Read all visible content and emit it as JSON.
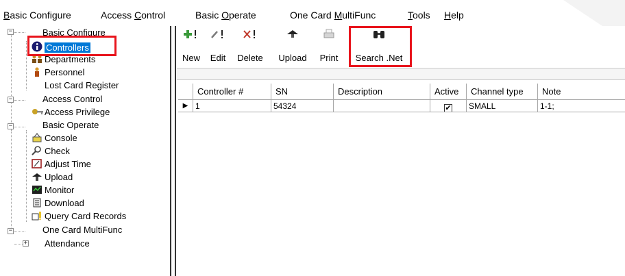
{
  "menu": [
    {
      "prefix": "",
      "accel": "B",
      "rest": "asic Configure"
    },
    {
      "prefix": "Access ",
      "accel": "C",
      "rest": "ontrol"
    },
    {
      "prefix": "Basic ",
      "accel": "O",
      "rest": "perate"
    },
    {
      "prefix": "One Card ",
      "accel": "M",
      "rest": "ultiFunc"
    },
    {
      "prefix": "",
      "accel": "T",
      "rest": "ools"
    },
    {
      "prefix": "",
      "accel": "H",
      "rest": "elp"
    }
  ],
  "tree": {
    "basic_configure": "Basic Configure",
    "controllers": "Controllers",
    "departments": "Departments",
    "personnel": "Personnel",
    "lost_card_register": "Lost Card Register",
    "access_control": "Access Control",
    "access_privilege": "Access Privilege",
    "basic_operate": "Basic Operate",
    "console": "Console",
    "check": "Check",
    "adjust_time": "Adjust Time",
    "upload": "Upload",
    "monitor": "Monitor",
    "download": "Download",
    "query_card_records": "Query Card Records",
    "one_card_multifunc": "One Card MultiFunc",
    "attendance": "Attendance",
    "expander_minus": "−",
    "expander_plus": "+"
  },
  "toolbar": {
    "new": "New",
    "edit": "Edit",
    "delete": "Delete",
    "upload": "Upload",
    "print": "Print",
    "search_net": "Search .Net"
  },
  "grid": {
    "columns": [
      "Controller #",
      "SN",
      "Description",
      "Active",
      "Channel type",
      "Note"
    ],
    "rows": [
      {
        "controller": "1",
        "sn": "54324",
        "description": "",
        "active": true,
        "active_mark": "✔",
        "channel_type": "SMALL",
        "note": "1-1;"
      }
    ],
    "row_indicator": "▶"
  },
  "colors": {
    "highlight_box": "#e8141c",
    "selection": "#0078d7"
  },
  "icons": {
    "new": "plus-icon",
    "edit": "pencil-icon",
    "delete": "x-icon",
    "upload": "upload-arrow-icon",
    "print": "printer-icon",
    "search_net": "binoculars-icon"
  }
}
